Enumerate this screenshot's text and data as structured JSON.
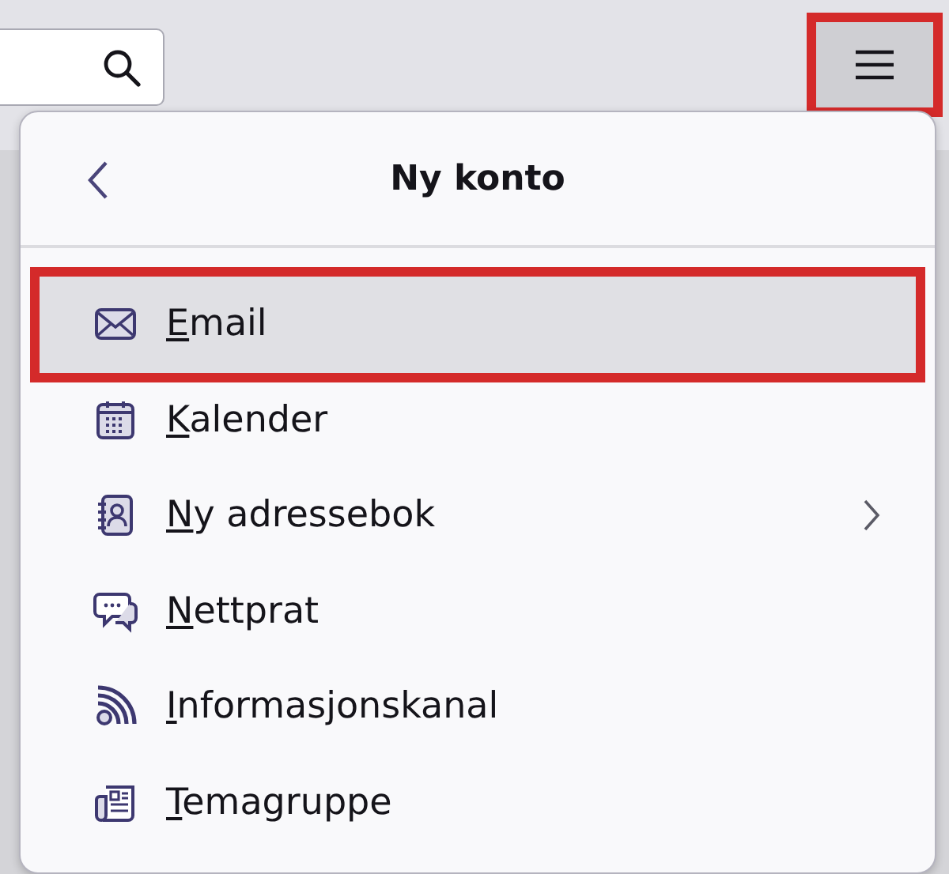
{
  "toolbar": {
    "menu_button": {
      "highlighted": true
    }
  },
  "panel": {
    "title": "Ny konto",
    "items": [
      {
        "label": "Email",
        "kind": "mail",
        "selected": true,
        "highlighted": true,
        "submenu": false
      },
      {
        "label": "Kalender",
        "kind": "calendar",
        "selected": false,
        "highlighted": false,
        "submenu": false
      },
      {
        "label": "Ny adressebok",
        "kind": "addressbook",
        "selected": false,
        "highlighted": false,
        "submenu": true
      },
      {
        "label": "Nettprat",
        "kind": "chat",
        "selected": false,
        "highlighted": false,
        "submenu": false
      },
      {
        "label": "Informasjonskanal",
        "kind": "feed",
        "selected": false,
        "highlighted": false,
        "submenu": false
      },
      {
        "label": "Temagruppe",
        "kind": "news",
        "selected": false,
        "highlighted": false,
        "submenu": false
      }
    ]
  }
}
